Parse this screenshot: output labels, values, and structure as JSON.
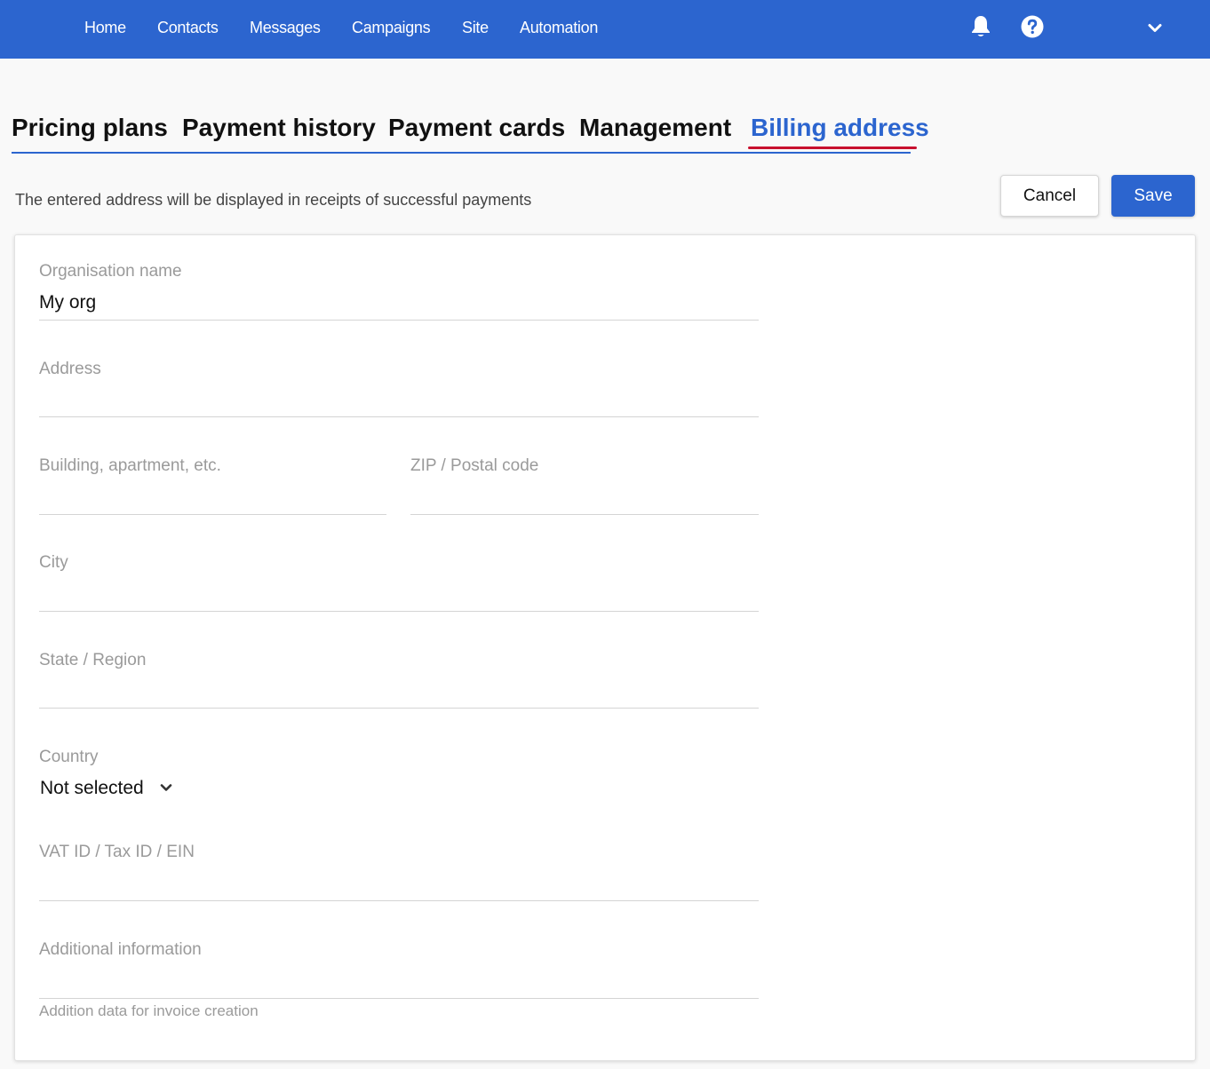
{
  "nav": {
    "items": [
      "Home",
      "Contacts",
      "Messages",
      "Campaigns",
      "Site",
      "Automation"
    ],
    "icons": [
      "bell-icon",
      "help-icon",
      "chevron-down-icon"
    ]
  },
  "tabs": {
    "items": [
      "Pricing plans",
      "Payment history",
      "Payment cards",
      "Management",
      "Billing address"
    ],
    "active": "Billing address"
  },
  "page": {
    "hint": "The entered address will be displayed in receipts of successful payments"
  },
  "actions": {
    "cancel_label": "Cancel",
    "save_label": "Save"
  },
  "form": {
    "org_name": {
      "label": "Organisation name",
      "value": "My org"
    },
    "address": {
      "label": "Address",
      "value": ""
    },
    "building": {
      "label": "Building, apartment, etc.",
      "value": ""
    },
    "zip": {
      "label": "ZIP / Postal code",
      "value": ""
    },
    "city": {
      "label": "City",
      "value": ""
    },
    "state": {
      "label": "State / Region",
      "value": ""
    },
    "country": {
      "label": "Country",
      "value": "Not selected"
    },
    "vat": {
      "label": "VAT ID / Tax ID / EIN",
      "value": ""
    },
    "additional": {
      "label": "Additional information",
      "value": "",
      "helper": "Addition data for invoice creation"
    }
  },
  "colors": {
    "primary": "#2c65cf",
    "active_underline": "#c8102e",
    "label_gray": "#9a9a9a"
  }
}
